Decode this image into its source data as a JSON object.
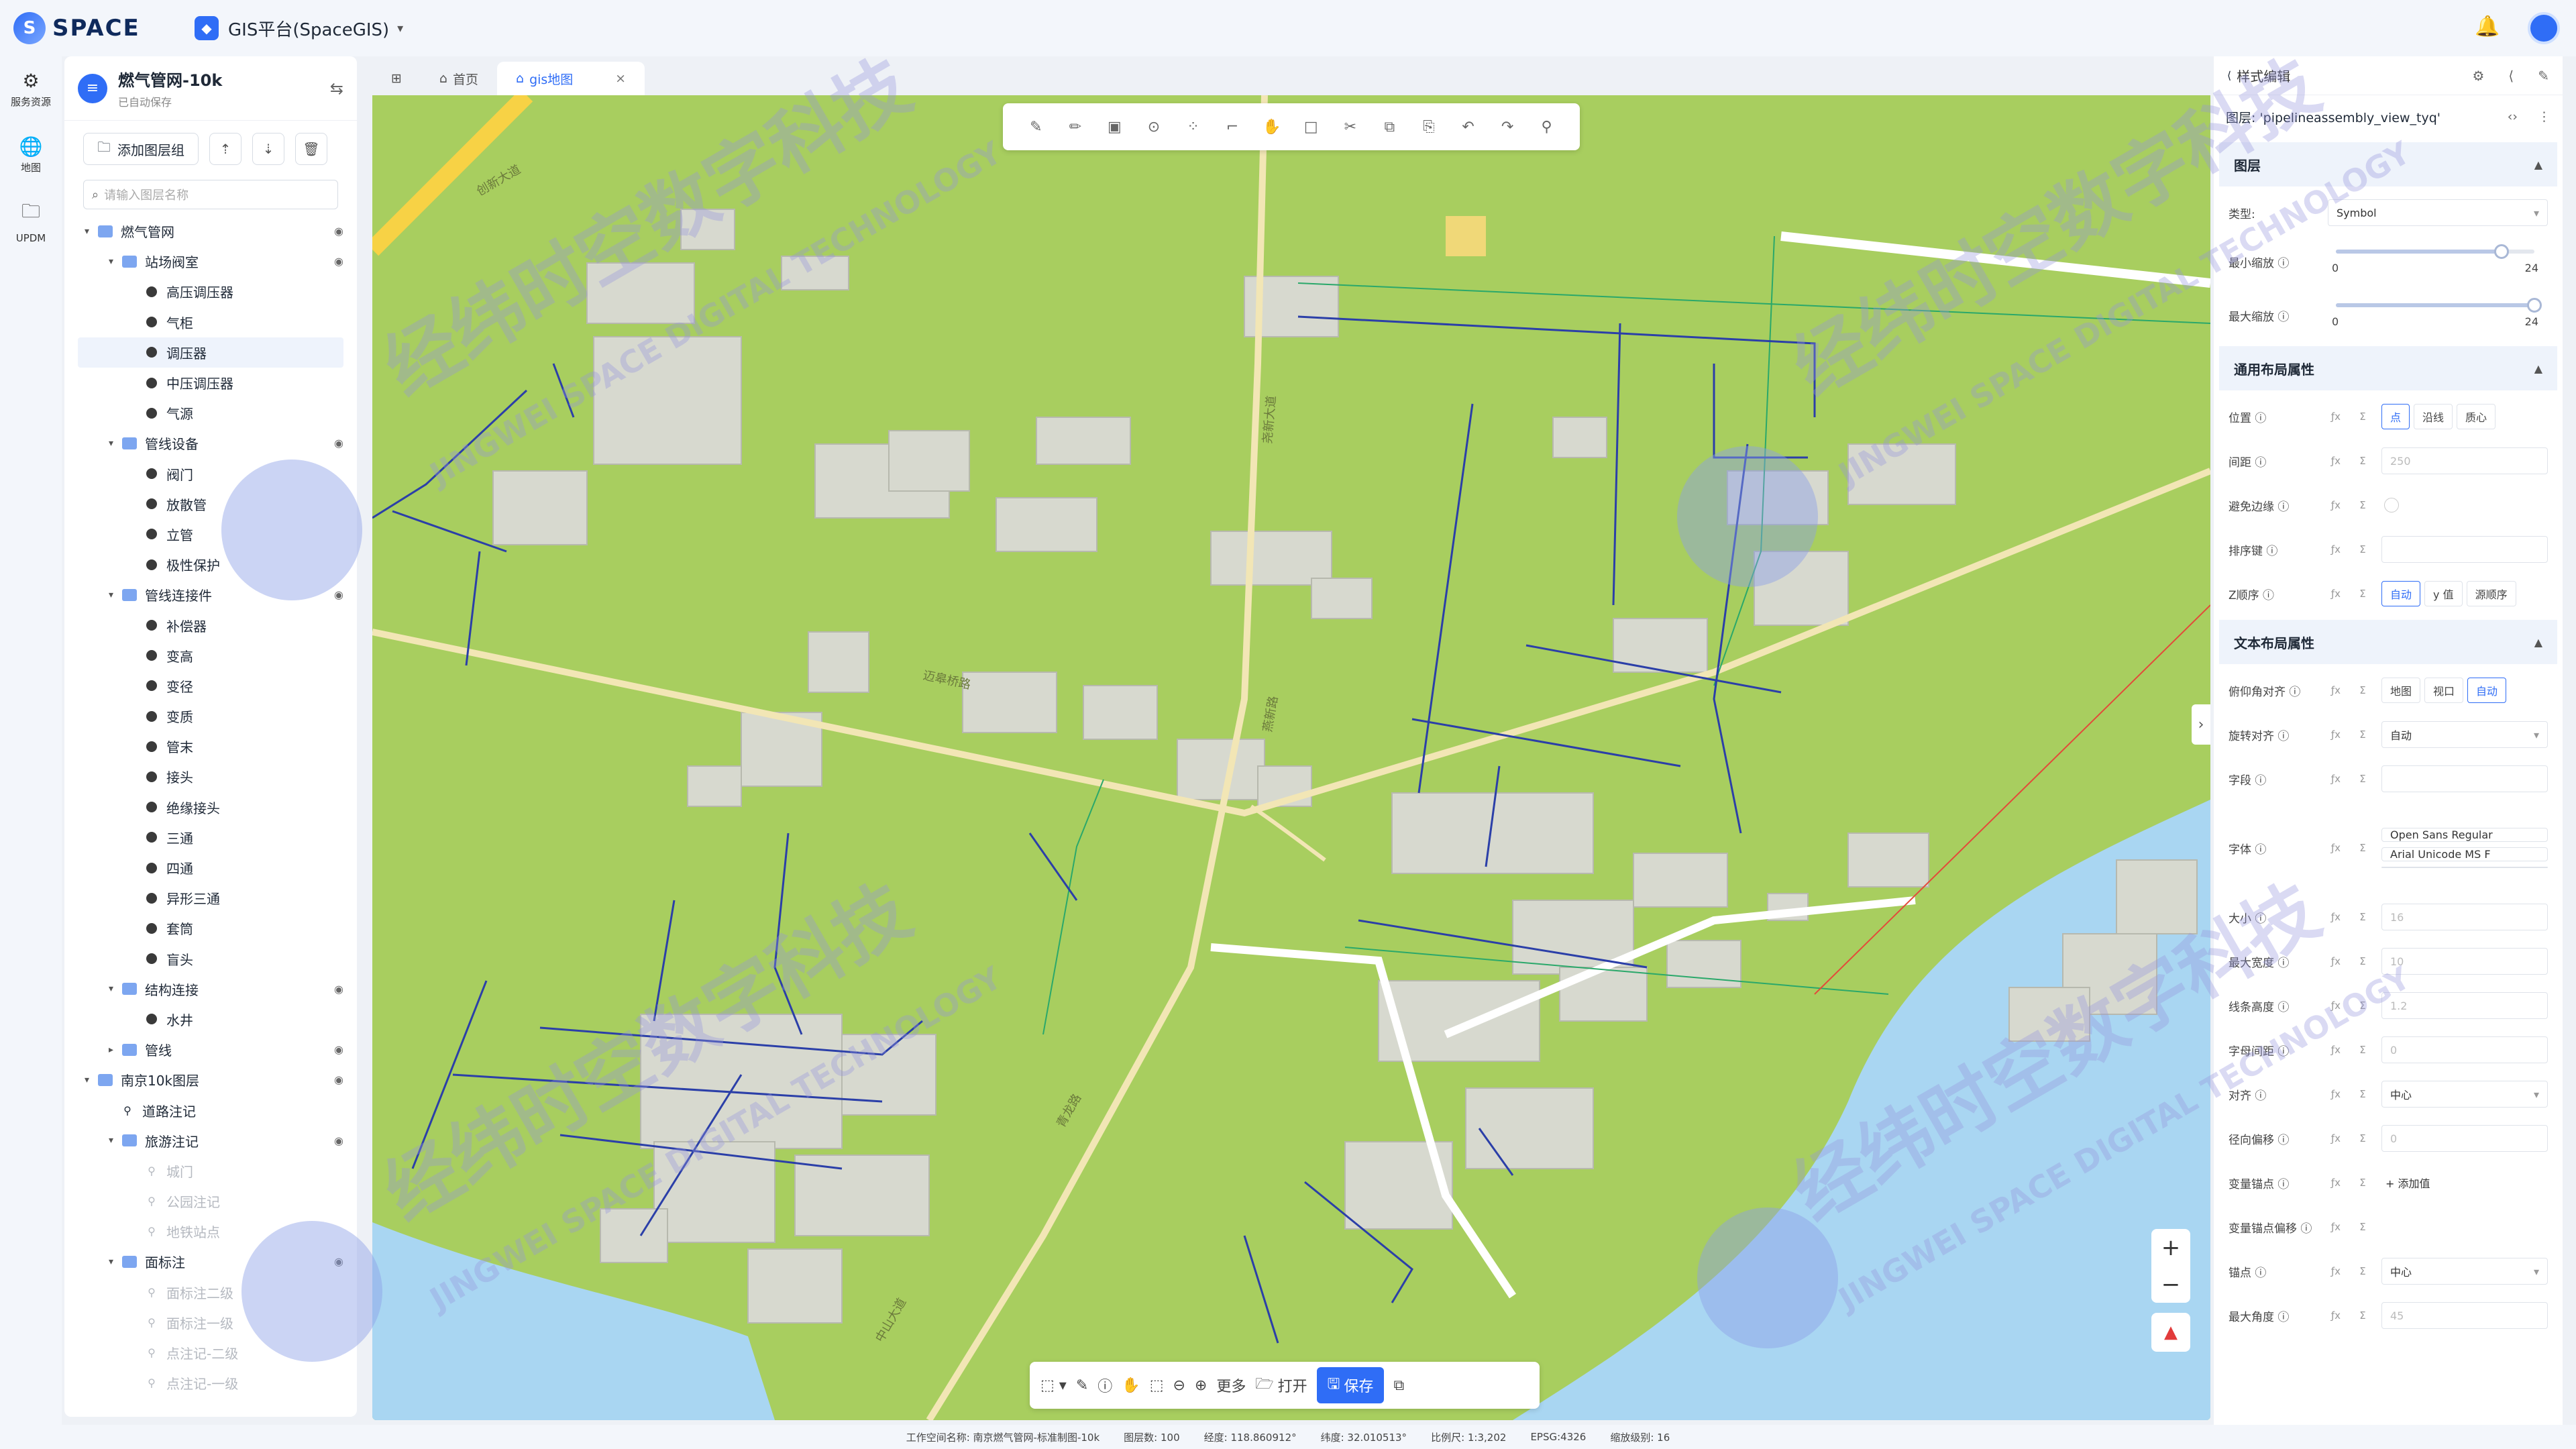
{
  "topbar": {
    "logo": "SPACE",
    "app_name": "GIS平台(SpaceGIS)"
  },
  "leftnav": [
    {
      "label": "服务资源",
      "icon": "gear-icon"
    },
    {
      "label": "地图",
      "icon": "globe-icon"
    },
    {
      "label": "UPDM",
      "icon": "folder-icon"
    }
  ],
  "layer_panel": {
    "title": "燃气管网-10k",
    "subtitle": "已自动保存",
    "add_group": "添加图层组",
    "search_placeholder": "请输入图层名称",
    "tree": [
      {
        "label": "燃气管网",
        "kind": "group",
        "level": 0,
        "eye": true
      },
      {
        "label": "站场阀室",
        "kind": "group",
        "level": 1,
        "eye": true
      },
      {
        "label": "高压调压器",
        "kind": "dot",
        "level": 2
      },
      {
        "label": "气柜",
        "kind": "dot",
        "level": 2
      },
      {
        "label": "调压器",
        "kind": "dot",
        "level": 2,
        "selected": true
      },
      {
        "label": "中压调压器",
        "kind": "dot",
        "level": 2
      },
      {
        "label": "气源",
        "kind": "dot",
        "level": 2
      },
      {
        "label": "管线设备",
        "kind": "group",
        "level": 1,
        "eye": true
      },
      {
        "label": "阀门",
        "kind": "dot",
        "level": 2
      },
      {
        "label": "放散管",
        "kind": "dot",
        "level": 2
      },
      {
        "label": "立管",
        "kind": "dot",
        "level": 2
      },
      {
        "label": "极性保护",
        "kind": "dot",
        "level": 2
      },
      {
        "label": "管线连接件",
        "kind": "group",
        "level": 1,
        "eye": true
      },
      {
        "label": "补偿器",
        "kind": "dot",
        "level": 2
      },
      {
        "label": "变高",
        "kind": "dot",
        "level": 2
      },
      {
        "label": "变径",
        "kind": "dot",
        "level": 2
      },
      {
        "label": "变质",
        "kind": "dot",
        "level": 2
      },
      {
        "label": "管末",
        "kind": "dot",
        "level": 2
      },
      {
        "label": "接头",
        "kind": "dot",
        "level": 2
      },
      {
        "label": "绝缘接头",
        "kind": "dot",
        "level": 2
      },
      {
        "label": "三通",
        "kind": "dot",
        "level": 2
      },
      {
        "label": "四通",
        "kind": "dot",
        "level": 2
      },
      {
        "label": "异形三通",
        "kind": "dot",
        "level": 2
      },
      {
        "label": "套筒",
        "kind": "dot",
        "level": 2
      },
      {
        "label": "盲头",
        "kind": "dot",
        "level": 2
      },
      {
        "label": "结构连接",
        "kind": "group",
        "level": 1,
        "eye": true
      },
      {
        "label": "水井",
        "kind": "dot",
        "level": 2
      },
      {
        "label": "管线",
        "kind": "group",
        "level": 1,
        "eye": true,
        "collapsed": true
      },
      {
        "label": "南京10k图层",
        "kind": "group",
        "level": 0,
        "eye": true
      },
      {
        "label": "道路注记",
        "kind": "pin",
        "level": 1
      },
      {
        "label": "旅游注记",
        "kind": "group",
        "level": 1,
        "eye": true
      },
      {
        "label": "城门",
        "kind": "pin",
        "level": 2,
        "dim": true
      },
      {
        "label": "公园注记",
        "kind": "pin",
        "level": 2,
        "dim": true
      },
      {
        "label": "地铁站点",
        "kind": "pin",
        "level": 2,
        "dim": true
      },
      {
        "label": "面标注",
        "kind": "group",
        "level": 1,
        "eye": true
      },
      {
        "label": "面标注二级",
        "kind": "pin",
        "level": 2,
        "dim": true
      },
      {
        "label": "面标注一级",
        "kind": "pin",
        "level": 2,
        "dim": true
      },
      {
        "label": "点注记-二级",
        "kind": "pin",
        "level": 2,
        "dim": true
      },
      {
        "label": "点注记-一级",
        "kind": "pin",
        "level": 2,
        "dim": true
      }
    ]
  },
  "tabs": [
    {
      "label": "首页",
      "active": false
    },
    {
      "label": "gis地图",
      "active": true
    }
  ],
  "map_bottom": {
    "more": "更多",
    "open": "打开",
    "save": "保存"
  },
  "style_panel": {
    "title": "样式编辑",
    "layer_title": "图层: 'pipelineassembly_view_tyq'",
    "sections": {
      "layer": "图层",
      "general": "通用布局属性",
      "text": "文本布局属性"
    },
    "type_label": "类型:",
    "type_value": "Symbol",
    "min_zoom": {
      "label": "最小缩放",
      "min": "0",
      "max": "24",
      "value": 20
    },
    "max_zoom": {
      "label": "最大缩放",
      "min": "0",
      "max": "24",
      "value": 24
    },
    "general_rows": [
      {
        "label": "位置",
        "seg": [
          "点",
          "沿线",
          "质心"
        ],
        "on": 0
      },
      {
        "label": "间距",
        "placeholder": "250"
      },
      {
        "label": "避免边缘",
        "toggle": true
      },
      {
        "label": "排序键",
        "placeholder": ""
      },
      {
        "label": "Z顺序",
        "seg": [
          "自动",
          "y 值",
          "源顺序"
        ],
        "on": 0
      }
    ],
    "text_rows": [
      {
        "label": "俯仰角对齐",
        "seg": [
          "地图",
          "视口",
          "自动"
        ],
        "on": 2
      },
      {
        "label": "旋转对齐",
        "value": "自动",
        "dropdown": true
      },
      {
        "label": "字段",
        "placeholder": ""
      },
      {
        "label": "字体",
        "values": [
          "Open Sans Regular",
          "Arial Unicode MS F"
        ]
      },
      {
        "label": "大小",
        "placeholder": "16"
      },
      {
        "label": "最大宽度",
        "placeholder": "10"
      },
      {
        "label": "线条高度",
        "placeholder": "1.2"
      },
      {
        "label": "字母间距",
        "placeholder": "0"
      },
      {
        "label": "对齐",
        "value": "中心",
        "dropdown": true
      },
      {
        "label": "径向偏移",
        "placeholder": "0"
      },
      {
        "label": "变量锚点",
        "add": "添加值"
      },
      {
        "label": "变量锚点偏移"
      },
      {
        "label": "锚点",
        "value": "中心",
        "dropdown": true
      },
      {
        "label": "最大角度",
        "placeholder": "45"
      }
    ]
  },
  "statusbar": [
    "工作空间名称: 南京燃气管网-标准制图-10k",
    "图层数: 100",
    "经度: 118.860912°",
    "纬度: 32.010513°",
    "比例尺: 1:3,202",
    "EPSG:4326",
    "缩放级别: 16"
  ],
  "watermark": {
    "cn": "经纬时空数字科技",
    "en": "JINGWEI SPACE DIGITAL TECHNOLOGY"
  },
  "road_labels": [
    "创新大道",
    "尧新大道",
    "迈皋桥路",
    "燕新路",
    "青龙路",
    "中山大道"
  ],
  "colors": {
    "accent": "#2f6df6",
    "map_bg": "#a8ce5f",
    "pipe": "#2b3fa8",
    "green_line": "#2aa86a",
    "building": "#d7d9cf"
  }
}
